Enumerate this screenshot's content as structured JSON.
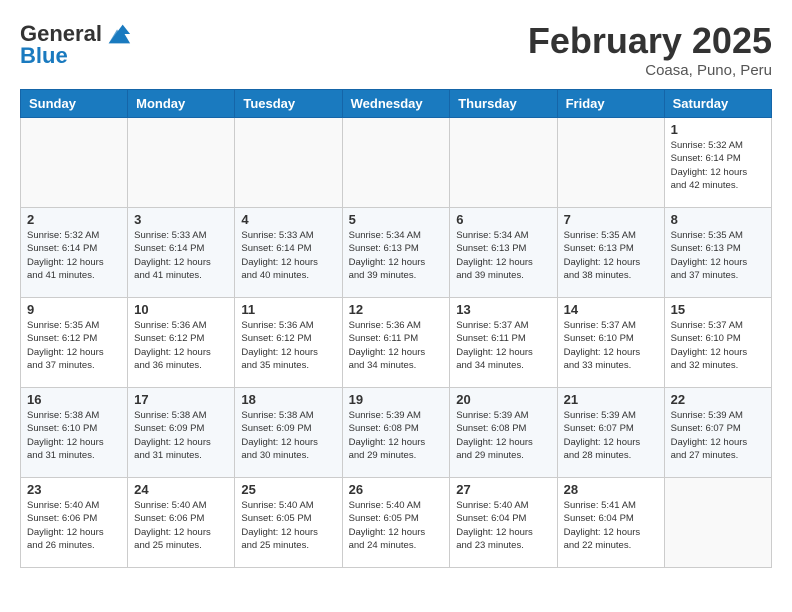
{
  "header": {
    "logo_line1": "General",
    "logo_line2": "Blue",
    "month_title": "February 2025",
    "location": "Coasa, Puno, Peru"
  },
  "days_of_week": [
    "Sunday",
    "Monday",
    "Tuesday",
    "Wednesday",
    "Thursday",
    "Friday",
    "Saturday"
  ],
  "weeks": [
    [
      {
        "day": "",
        "info": ""
      },
      {
        "day": "",
        "info": ""
      },
      {
        "day": "",
        "info": ""
      },
      {
        "day": "",
        "info": ""
      },
      {
        "day": "",
        "info": ""
      },
      {
        "day": "",
        "info": ""
      },
      {
        "day": "1",
        "info": "Sunrise: 5:32 AM\nSunset: 6:14 PM\nDaylight: 12 hours and 42 minutes."
      }
    ],
    [
      {
        "day": "2",
        "info": "Sunrise: 5:32 AM\nSunset: 6:14 PM\nDaylight: 12 hours and 41 minutes."
      },
      {
        "day": "3",
        "info": "Sunrise: 5:33 AM\nSunset: 6:14 PM\nDaylight: 12 hours and 41 minutes."
      },
      {
        "day": "4",
        "info": "Sunrise: 5:33 AM\nSunset: 6:14 PM\nDaylight: 12 hours and 40 minutes."
      },
      {
        "day": "5",
        "info": "Sunrise: 5:34 AM\nSunset: 6:13 PM\nDaylight: 12 hours and 39 minutes."
      },
      {
        "day": "6",
        "info": "Sunrise: 5:34 AM\nSunset: 6:13 PM\nDaylight: 12 hours and 39 minutes."
      },
      {
        "day": "7",
        "info": "Sunrise: 5:35 AM\nSunset: 6:13 PM\nDaylight: 12 hours and 38 minutes."
      },
      {
        "day": "8",
        "info": "Sunrise: 5:35 AM\nSunset: 6:13 PM\nDaylight: 12 hours and 37 minutes."
      }
    ],
    [
      {
        "day": "9",
        "info": "Sunrise: 5:35 AM\nSunset: 6:12 PM\nDaylight: 12 hours and 37 minutes."
      },
      {
        "day": "10",
        "info": "Sunrise: 5:36 AM\nSunset: 6:12 PM\nDaylight: 12 hours and 36 minutes."
      },
      {
        "day": "11",
        "info": "Sunrise: 5:36 AM\nSunset: 6:12 PM\nDaylight: 12 hours and 35 minutes."
      },
      {
        "day": "12",
        "info": "Sunrise: 5:36 AM\nSunset: 6:11 PM\nDaylight: 12 hours and 34 minutes."
      },
      {
        "day": "13",
        "info": "Sunrise: 5:37 AM\nSunset: 6:11 PM\nDaylight: 12 hours and 34 minutes."
      },
      {
        "day": "14",
        "info": "Sunrise: 5:37 AM\nSunset: 6:10 PM\nDaylight: 12 hours and 33 minutes."
      },
      {
        "day": "15",
        "info": "Sunrise: 5:37 AM\nSunset: 6:10 PM\nDaylight: 12 hours and 32 minutes."
      }
    ],
    [
      {
        "day": "16",
        "info": "Sunrise: 5:38 AM\nSunset: 6:10 PM\nDaylight: 12 hours and 31 minutes."
      },
      {
        "day": "17",
        "info": "Sunrise: 5:38 AM\nSunset: 6:09 PM\nDaylight: 12 hours and 31 minutes."
      },
      {
        "day": "18",
        "info": "Sunrise: 5:38 AM\nSunset: 6:09 PM\nDaylight: 12 hours and 30 minutes."
      },
      {
        "day": "19",
        "info": "Sunrise: 5:39 AM\nSunset: 6:08 PM\nDaylight: 12 hours and 29 minutes."
      },
      {
        "day": "20",
        "info": "Sunrise: 5:39 AM\nSunset: 6:08 PM\nDaylight: 12 hours and 29 minutes."
      },
      {
        "day": "21",
        "info": "Sunrise: 5:39 AM\nSunset: 6:07 PM\nDaylight: 12 hours and 28 minutes."
      },
      {
        "day": "22",
        "info": "Sunrise: 5:39 AM\nSunset: 6:07 PM\nDaylight: 12 hours and 27 minutes."
      }
    ],
    [
      {
        "day": "23",
        "info": "Sunrise: 5:40 AM\nSunset: 6:06 PM\nDaylight: 12 hours and 26 minutes."
      },
      {
        "day": "24",
        "info": "Sunrise: 5:40 AM\nSunset: 6:06 PM\nDaylight: 12 hours and 25 minutes."
      },
      {
        "day": "25",
        "info": "Sunrise: 5:40 AM\nSunset: 6:05 PM\nDaylight: 12 hours and 25 minutes."
      },
      {
        "day": "26",
        "info": "Sunrise: 5:40 AM\nSunset: 6:05 PM\nDaylight: 12 hours and 24 minutes."
      },
      {
        "day": "27",
        "info": "Sunrise: 5:40 AM\nSunset: 6:04 PM\nDaylight: 12 hours and 23 minutes."
      },
      {
        "day": "28",
        "info": "Sunrise: 5:41 AM\nSunset: 6:04 PM\nDaylight: 12 hours and 22 minutes."
      },
      {
        "day": "",
        "info": ""
      }
    ]
  ]
}
